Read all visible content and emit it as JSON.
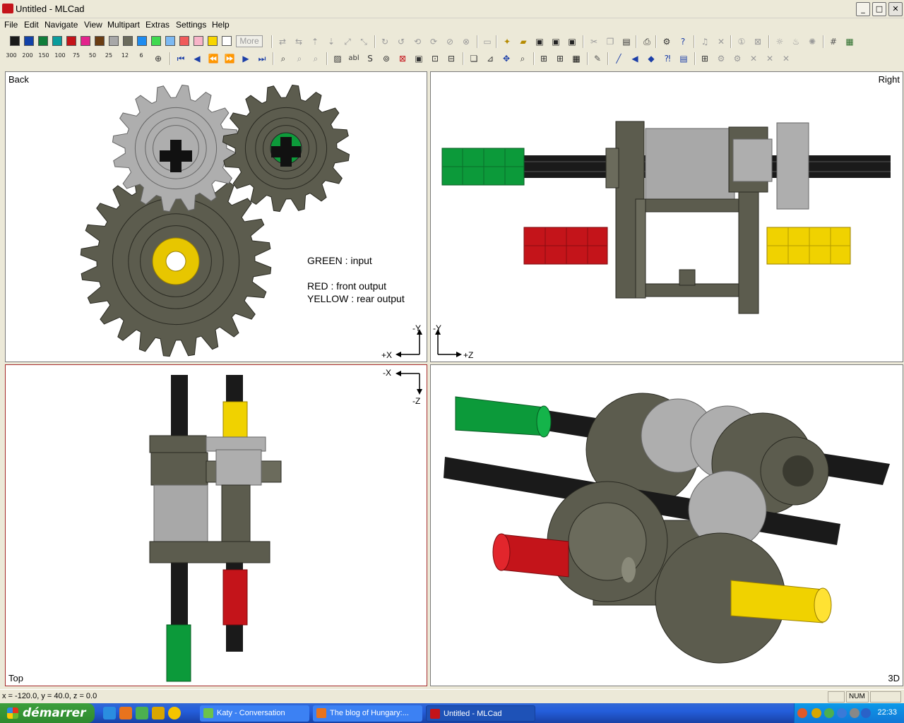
{
  "window": {
    "title": "Untitled - MLCad",
    "min": "_",
    "max": "□",
    "close": "✕"
  },
  "menu": [
    "File",
    "Edit",
    "Navigate",
    "View",
    "Multipart",
    "Extras",
    "Settings",
    "Help"
  ],
  "palette": {
    "colors": [
      "#1a1a1a",
      "#1342a8",
      "#107d3a",
      "#0a9c9c",
      "#c4141a",
      "#e3238c",
      "#6a3d13",
      "#a8a8a8",
      "#6b6b5c",
      "#1e8cf0",
      "#3fd94f",
      "#7cb9f2",
      "#f05a5a",
      "#f8b4c8",
      "#f8d600",
      "#ffffff"
    ],
    "more_label": "More"
  },
  "zoom_levels": [
    "300",
    "200",
    "150",
    "100",
    "75",
    "50",
    "25",
    "12",
    "6"
  ],
  "viewports": {
    "back": {
      "label": "Back",
      "axis_y": "-Y",
      "axis_x": "+X"
    },
    "right": {
      "label": "Right",
      "axis_y": "-Y",
      "axis_x": "+Z"
    },
    "top": {
      "label": "Top",
      "axis_x": "-X",
      "axis_z": "-Z"
    },
    "three_d": {
      "label": "3D"
    }
  },
  "annotation": {
    "line1": "GREEN : input",
    "line2": "RED : front output",
    "line3": "YELLOW : rear output"
  },
  "status": {
    "coords": "x = -120.0, y = 40.0, z = 0.0",
    "num": "NUM"
  },
  "taskbar": {
    "start": "démarrer",
    "tasks": [
      "Katy - Conversation",
      "The blog of Hungary:...",
      "Untitled - MLCad"
    ],
    "clock": "22:33"
  },
  "colors": {
    "gear_dark": "#5c5c4e",
    "gear_light": "#aeaeae",
    "axle": "#1a1a1a",
    "green": "#0c9a3a",
    "red": "#c4141a",
    "yellow": "#f0d200"
  }
}
